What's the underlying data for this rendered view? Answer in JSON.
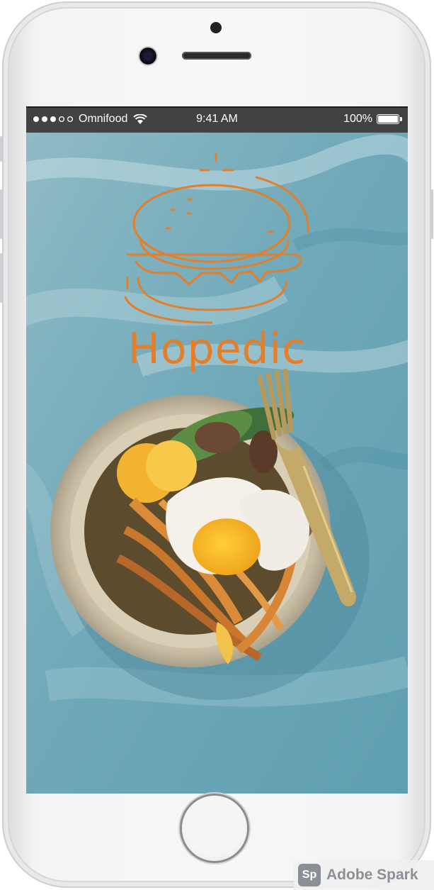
{
  "status_bar": {
    "carrier": "Omnifood",
    "time": "9:41 AM",
    "battery": "100%",
    "signal_bars_filled": 3,
    "signal_bars_total": 5
  },
  "app": {
    "brand_name": "Hopedic",
    "logo_icon": "burger-icon",
    "background_image": "food-bowl-egg-noodles-photo"
  },
  "watermark": {
    "logo_text": "Sp",
    "text": "Adobe Spark"
  },
  "colors": {
    "brand": "#e57e29",
    "background": "#72aab8",
    "status_bar": "#404244"
  }
}
